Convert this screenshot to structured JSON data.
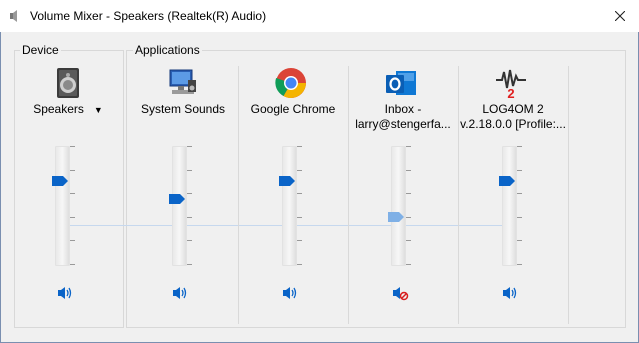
{
  "window": {
    "title": "Volume Mixer - Speakers (Realtek(R) Audio)"
  },
  "groups": {
    "device_label": "Device",
    "applications_label": "Applications"
  },
  "device": {
    "name": "Speakers",
    "icon": "speaker-device-icon",
    "volume": 0.7,
    "muted": false
  },
  "apps": [
    {
      "line1": "System Sounds",
      "line2": "",
      "icon": "system-sounds-icon",
      "volume": 0.55,
      "muted": false
    },
    {
      "line1": "Google Chrome",
      "line2": "",
      "icon": "chrome-icon",
      "volume": 0.7,
      "muted": false
    },
    {
      "line1": "Inbox -",
      "line2": "larry@stengerfa...",
      "icon": "outlook-icon",
      "volume": 0.4,
      "muted": true
    },
    {
      "line1": "LOG4OM 2",
      "line2": "v.2.18.0.0 [Profile:...",
      "icon": "log4om-icon",
      "volume": 0.7,
      "muted": false
    }
  ],
  "colors": {
    "accent": "#0a64c8",
    "mute_red": "#d81e1e"
  }
}
